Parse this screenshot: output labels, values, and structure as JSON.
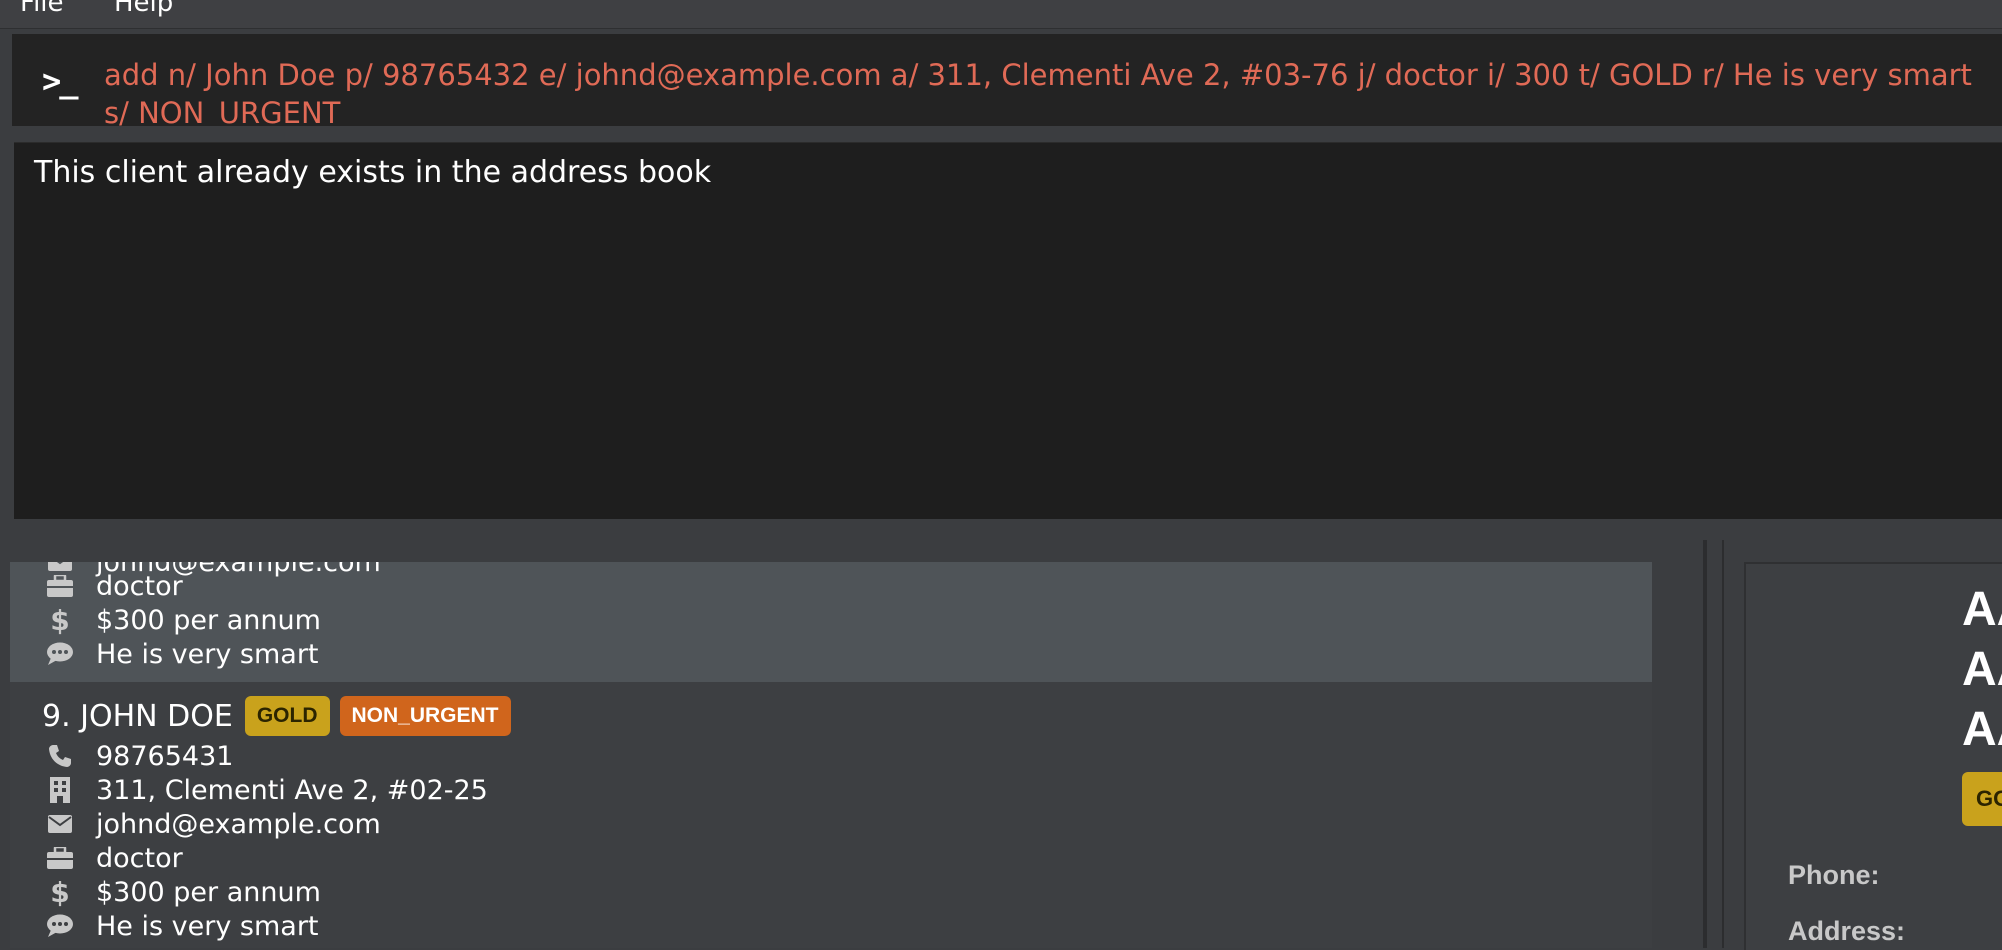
{
  "menu": {
    "file": "File",
    "help": "Help"
  },
  "command": {
    "prompt": ">_",
    "text": "add n/ John Doe p/ 98765432 e/ johnd@example.com a/ 311, Clementi Ave 2, #03-76 j/ doctor i/ 300 t/ GOLD r/ He is very smart s/ NON_URGENT"
  },
  "result": {
    "message": "This client already exists in the address book"
  },
  "list": {
    "selected_card": {
      "partial_email": "johnd@example.com",
      "job": "doctor",
      "income": "$300 per annum",
      "remark": "He is very smart"
    },
    "card": {
      "title": "9. JOHN DOE",
      "tier": "GOLD",
      "urgency": "NON_URGENT",
      "phone": "98765431",
      "address": "311, Clementi Ave 2, #02-25",
      "email": "johnd@example.com",
      "job": "doctor",
      "income": "$300 per annum",
      "remark": "He is very smart"
    }
  },
  "detail": {
    "name_lines": [
      "AA",
      "AA",
      "AA"
    ],
    "tier_badge": "GOLD",
    "phone_label": "Phone:",
    "address_label": "Address:"
  },
  "icons": {
    "briefcase": "briefcase-icon",
    "dollar": "dollar-icon",
    "comment": "comment-icon",
    "phone": "phone-icon",
    "building": "building-icon",
    "envelope": "envelope-icon"
  },
  "colors": {
    "command_text": "#e06a56",
    "gold_badge": "#c9a21c",
    "urgency_badge": "#d0651c",
    "selected_card": "#4f5458"
  }
}
